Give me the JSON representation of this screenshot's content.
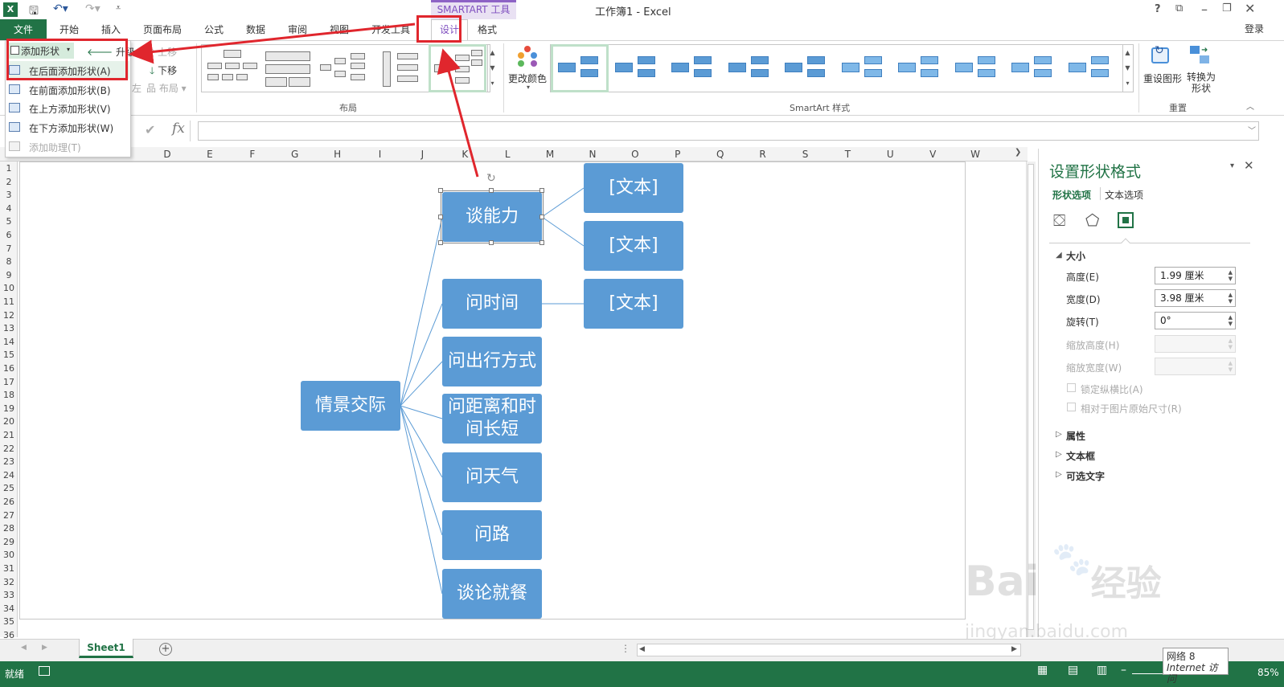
{
  "app": {
    "title": "工作簿1 - Excel",
    "context_group": "SMARTART 工具",
    "login": "登录",
    "window_help": "?"
  },
  "tabs": {
    "file": "文件",
    "items": [
      "开始",
      "插入",
      "页面布局",
      "公式",
      "数据",
      "审阅",
      "视图",
      "开发工具",
      "设计",
      "格式"
    ]
  },
  "ribbon": {
    "add_shape": "添加形状",
    "promote": "升级",
    "move_up": "上移",
    "move_down": "下移",
    "right_to_left": "左",
    "layout_btn": "布局",
    "layout_group": "布局",
    "change_colors": "更改颜色",
    "styles_group": "SmartArt 样式",
    "reset_graphic": "重设图形",
    "convert_line1": "转换为",
    "convert_line2": "形状",
    "reset_group": "重置"
  },
  "dropdown": {
    "items": [
      {
        "label": "在后面添加形状(A)",
        "enabled": true
      },
      {
        "label": "在前面添加形状(B)",
        "enabled": true
      },
      {
        "label": "在上方添加形状(V)",
        "enabled": true
      },
      {
        "label": "在下方添加形状(W)",
        "enabled": true
      },
      {
        "label": "添加助理(T)",
        "enabled": false
      }
    ]
  },
  "formula_bar": {
    "fx": "fx",
    "value": ""
  },
  "columns": [
    "D",
    "E",
    "F",
    "G",
    "H",
    "I",
    "J",
    "K",
    "L",
    "M",
    "N",
    "O",
    "P",
    "Q",
    "R",
    "S",
    "T",
    "U",
    "V",
    "W"
  ],
  "rows": [
    "1",
    "2",
    "3",
    "4",
    "5",
    "6",
    "7",
    "8",
    "9",
    "10",
    "11",
    "12",
    "13",
    "14",
    "15",
    "16",
    "17",
    "18",
    "19",
    "20",
    "21",
    "22",
    "23",
    "24",
    "25",
    "26",
    "27",
    "28",
    "29",
    "30",
    "31",
    "32",
    "33",
    "34",
    "35",
    "36"
  ],
  "smartart": {
    "root": "情景交际",
    "children": [
      "谈能力",
      "问时间",
      "问出行方式",
      "问距离和时间长短",
      "问天气",
      "问路",
      "谈论就餐"
    ],
    "grandchildren": [
      "[文本]",
      "[文本]",
      "[文本]"
    ],
    "node_color": "#5b9bd5"
  },
  "format_pane": {
    "title": "设置形状格式",
    "tab_shape": "形状选项",
    "tab_text": "文本选项",
    "section_size": "大小",
    "height_label": "高度(E)",
    "height_value": "1.99 厘米",
    "width_label": "宽度(D)",
    "width_value": "3.98 厘米",
    "rotation_label": "旋转(T)",
    "rotation_value": "0°",
    "scale_h_label": "缩放高度(H)",
    "scale_w_label": "缩放宽度(W)",
    "lock_ratio": "锁定纵横比(A)",
    "relative_orig": "相对于图片原始尺寸(R)",
    "section_props": "属性",
    "section_textbox": "文本框",
    "section_alt": "可选文字"
  },
  "sheet": {
    "tab": "Sheet1"
  },
  "status": {
    "ready": "就绪",
    "zoom": "85%",
    "tooltip_line1": "网络 8",
    "tooltip_line2": "Internet 访问"
  },
  "watermark": {
    "line1": "Bai",
    "line2": "经验",
    "url": "jingyan.baidu.com"
  },
  "colors": {
    "excel_green": "#217346",
    "accent_purple": "#7f4fbf",
    "annotation_red": "#e0262d"
  }
}
